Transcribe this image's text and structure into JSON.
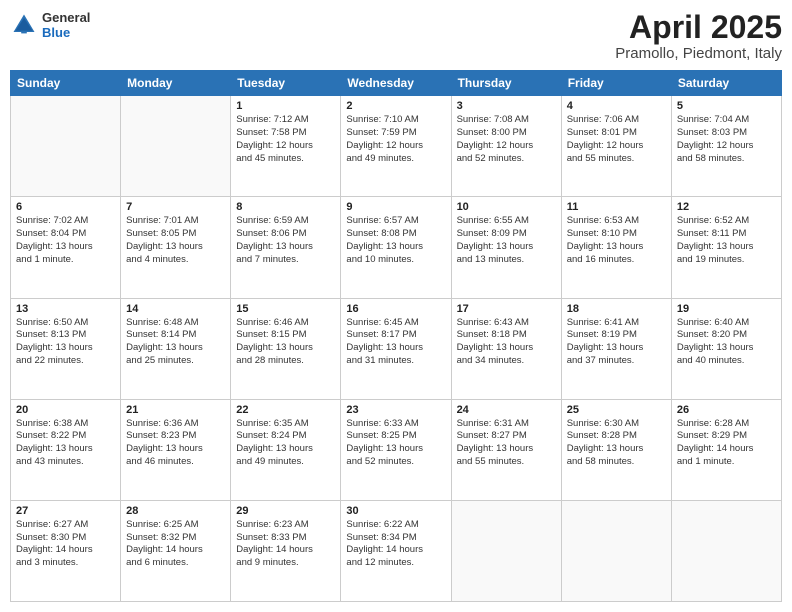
{
  "header": {
    "logo_general": "General",
    "logo_blue": "Blue",
    "month_title": "April 2025",
    "location": "Pramollo, Piedmont, Italy"
  },
  "days_of_week": [
    "Sunday",
    "Monday",
    "Tuesday",
    "Wednesday",
    "Thursday",
    "Friday",
    "Saturday"
  ],
  "weeks": [
    [
      {
        "day": "",
        "info": ""
      },
      {
        "day": "",
        "info": ""
      },
      {
        "day": "1",
        "info": "Sunrise: 7:12 AM\nSunset: 7:58 PM\nDaylight: 12 hours\nand 45 minutes."
      },
      {
        "day": "2",
        "info": "Sunrise: 7:10 AM\nSunset: 7:59 PM\nDaylight: 12 hours\nand 49 minutes."
      },
      {
        "day": "3",
        "info": "Sunrise: 7:08 AM\nSunset: 8:00 PM\nDaylight: 12 hours\nand 52 minutes."
      },
      {
        "day": "4",
        "info": "Sunrise: 7:06 AM\nSunset: 8:01 PM\nDaylight: 12 hours\nand 55 minutes."
      },
      {
        "day": "5",
        "info": "Sunrise: 7:04 AM\nSunset: 8:03 PM\nDaylight: 12 hours\nand 58 minutes."
      }
    ],
    [
      {
        "day": "6",
        "info": "Sunrise: 7:02 AM\nSunset: 8:04 PM\nDaylight: 13 hours\nand 1 minute."
      },
      {
        "day": "7",
        "info": "Sunrise: 7:01 AM\nSunset: 8:05 PM\nDaylight: 13 hours\nand 4 minutes."
      },
      {
        "day": "8",
        "info": "Sunrise: 6:59 AM\nSunset: 8:06 PM\nDaylight: 13 hours\nand 7 minutes."
      },
      {
        "day": "9",
        "info": "Sunrise: 6:57 AM\nSunset: 8:08 PM\nDaylight: 13 hours\nand 10 minutes."
      },
      {
        "day": "10",
        "info": "Sunrise: 6:55 AM\nSunset: 8:09 PM\nDaylight: 13 hours\nand 13 minutes."
      },
      {
        "day": "11",
        "info": "Sunrise: 6:53 AM\nSunset: 8:10 PM\nDaylight: 13 hours\nand 16 minutes."
      },
      {
        "day": "12",
        "info": "Sunrise: 6:52 AM\nSunset: 8:11 PM\nDaylight: 13 hours\nand 19 minutes."
      }
    ],
    [
      {
        "day": "13",
        "info": "Sunrise: 6:50 AM\nSunset: 8:13 PM\nDaylight: 13 hours\nand 22 minutes."
      },
      {
        "day": "14",
        "info": "Sunrise: 6:48 AM\nSunset: 8:14 PM\nDaylight: 13 hours\nand 25 minutes."
      },
      {
        "day": "15",
        "info": "Sunrise: 6:46 AM\nSunset: 8:15 PM\nDaylight: 13 hours\nand 28 minutes."
      },
      {
        "day": "16",
        "info": "Sunrise: 6:45 AM\nSunset: 8:17 PM\nDaylight: 13 hours\nand 31 minutes."
      },
      {
        "day": "17",
        "info": "Sunrise: 6:43 AM\nSunset: 8:18 PM\nDaylight: 13 hours\nand 34 minutes."
      },
      {
        "day": "18",
        "info": "Sunrise: 6:41 AM\nSunset: 8:19 PM\nDaylight: 13 hours\nand 37 minutes."
      },
      {
        "day": "19",
        "info": "Sunrise: 6:40 AM\nSunset: 8:20 PM\nDaylight: 13 hours\nand 40 minutes."
      }
    ],
    [
      {
        "day": "20",
        "info": "Sunrise: 6:38 AM\nSunset: 8:22 PM\nDaylight: 13 hours\nand 43 minutes."
      },
      {
        "day": "21",
        "info": "Sunrise: 6:36 AM\nSunset: 8:23 PM\nDaylight: 13 hours\nand 46 minutes."
      },
      {
        "day": "22",
        "info": "Sunrise: 6:35 AM\nSunset: 8:24 PM\nDaylight: 13 hours\nand 49 minutes."
      },
      {
        "day": "23",
        "info": "Sunrise: 6:33 AM\nSunset: 8:25 PM\nDaylight: 13 hours\nand 52 minutes."
      },
      {
        "day": "24",
        "info": "Sunrise: 6:31 AM\nSunset: 8:27 PM\nDaylight: 13 hours\nand 55 minutes."
      },
      {
        "day": "25",
        "info": "Sunrise: 6:30 AM\nSunset: 8:28 PM\nDaylight: 13 hours\nand 58 minutes."
      },
      {
        "day": "26",
        "info": "Sunrise: 6:28 AM\nSunset: 8:29 PM\nDaylight: 14 hours\nand 1 minute."
      }
    ],
    [
      {
        "day": "27",
        "info": "Sunrise: 6:27 AM\nSunset: 8:30 PM\nDaylight: 14 hours\nand 3 minutes."
      },
      {
        "day": "28",
        "info": "Sunrise: 6:25 AM\nSunset: 8:32 PM\nDaylight: 14 hours\nand 6 minutes."
      },
      {
        "day": "29",
        "info": "Sunrise: 6:23 AM\nSunset: 8:33 PM\nDaylight: 14 hours\nand 9 minutes."
      },
      {
        "day": "30",
        "info": "Sunrise: 6:22 AM\nSunset: 8:34 PM\nDaylight: 14 hours\nand 12 minutes."
      },
      {
        "day": "",
        "info": ""
      },
      {
        "day": "",
        "info": ""
      },
      {
        "day": "",
        "info": ""
      }
    ]
  ]
}
